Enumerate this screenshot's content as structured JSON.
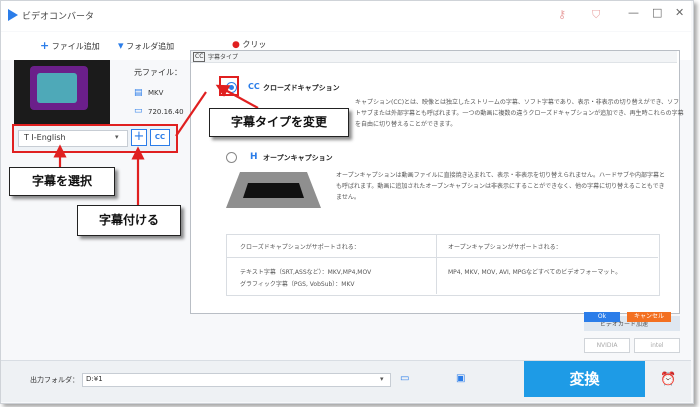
{
  "window": {
    "title": "ビデオコンバータ",
    "controls": {
      "minimize": "—",
      "maximize": "□",
      "close": "✕"
    },
    "title_icons": [
      "key-icon",
      "cart-icon"
    ]
  },
  "toolbar": {
    "add_file_icon": "+",
    "add_file": "ファイル追加",
    "add_folder": "フォルダ追加",
    "clip": "クリッ"
  },
  "item": {
    "source_label": "元ファイル：",
    "format": "MKV",
    "resolution": "720.16.40"
  },
  "subtitle": {
    "selected": "T I-English",
    "caret": "▾",
    "add_label": "+",
    "cc_label": "CC"
  },
  "dialog": {
    "title_icon": "CC",
    "title": "字幕タイプ",
    "closed_caption": {
      "mark": "CC",
      "label": "クローズドキャプション",
      "desc": "キャプション(CC)とは、映像とは独立したストリームの字幕、ソフト字幕であり、表示・非表示の切り替えができ、ソフトサブまたは外部字幕とも呼ばれます。一つの動画に複数の違うクローズドキャプションが追加でき、再生時これらの字幕を自由に切り替えることができます。"
    },
    "open_caption": {
      "mark": "H",
      "label": "オープンキャプション",
      "desc": "オープンキャプションは動画ファイルに直接焼き込まれて、表示・非表示を切り替えられません。ハードサブや内部字幕とも呼ばれます。動画に追加されたオープンキャプションは非表示にすることができなく、他の字幕に切り替えることもできません。"
    },
    "table": {
      "cc_header": "クローズドキャプションがサポートされる：",
      "open_header": "オープンキャプションがサポートされる：",
      "cc_text": "テキスト字幕（SRT,ASSなど）：MKV,MP4,MOV",
      "cc_graphic": "グラフィック字幕（PGS, VobSub）：MKV",
      "open_formats": "MP4, MKV, MOV, AVI, MPGなどすべてのビデオフォーマット。"
    },
    "ok": "Ok",
    "cancel": "キャンセル"
  },
  "gpu": {
    "label": "ビデオカード加速",
    "nvidia": "NVIDIA",
    "intel": "intel"
  },
  "bottom": {
    "output_label": "出力フォルダ：",
    "output_path": "D:¥1",
    "caret": "▾",
    "convert": "変換"
  },
  "annotations": {
    "change_type": "字幕タイプを変更",
    "select_sub": "字幕を選択",
    "add_sub": "字幕付ける"
  },
  "colors": {
    "accent": "#2b7de9",
    "highlight": "#e02020",
    "cancel": "#f37021",
    "convert": "#1e9be6"
  }
}
